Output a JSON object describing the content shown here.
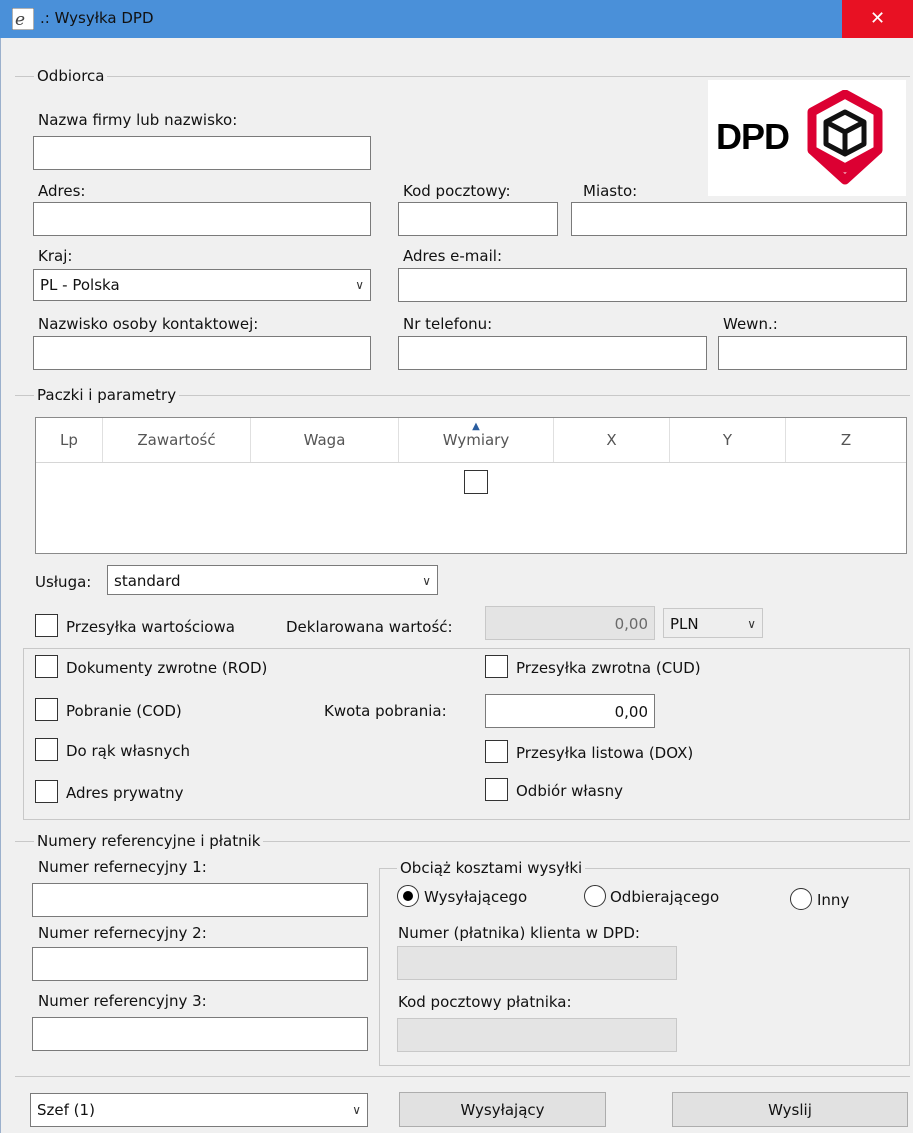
{
  "window": {
    "title": ".: Wysyłka DPD",
    "close_glyph": "✕"
  },
  "recipient": {
    "section_title": "Odbiorca",
    "company_label": "Nazwa firmy lub nazwisko:",
    "company_value": "",
    "address_label": "Adres:",
    "address_value": "",
    "postal_label": "Kod pocztowy:",
    "postal_value": "",
    "city_label": "Miasto:",
    "city_value": "",
    "country_label": "Kraj:",
    "country_value": "PL - Polska",
    "email_label": "Adres e-mail:",
    "email_value": "",
    "contact_label": "Nazwisko osoby kontaktowej:",
    "contact_value": "",
    "phone_label": "Nr telefonu:",
    "phone_value": "",
    "ext_label": "Wewn.:",
    "ext_value": ""
  },
  "logo": {
    "text": "DPD",
    "brand_color": "#dc0032"
  },
  "packages": {
    "section_title": "Paczki i parametry",
    "columns": [
      "Lp",
      "Zawartość",
      "Waga",
      "Wymiary",
      "X",
      "Y",
      "Z"
    ],
    "sorted_column": "Wymiary",
    "service_label": "Usługa:",
    "service_value": "standard",
    "valuable_label": "Przesyłka wartościowa",
    "valuable_checked": false,
    "declared_label": "Deklarowana wartość:",
    "declared_value": "0,00",
    "currency_value": "PLN",
    "options": {
      "rod_label": "Dokumenty zwrotne (ROD)",
      "cud_label": "Przesyłka zwrotna (CUD)",
      "cod_label": "Pobranie (COD)",
      "cod_amount_label": "Kwota pobrania:",
      "cod_amount_value": "0,00",
      "own_hands_label": "Do rąk własnych",
      "dox_label": "Przesyłka listowa (DOX)",
      "private_label": "Adres prywatny",
      "self_pickup_label": "Odbiór własny"
    }
  },
  "references": {
    "section_title": "Numery referencyjne i płatnik",
    "ref1_label": "Numer refernecyjny 1:",
    "ref1_value": "",
    "ref2_label": "Numer refernecyjny 2:",
    "ref2_value": "",
    "ref3_label": "Numer referencyjny 3:",
    "ref3_value": "",
    "payer": {
      "title": "Obciąż kosztami wysyłki",
      "sender_label": "Wysyłającego",
      "receiver_label": "Odbierającego",
      "other_label": "Inny",
      "selected": "Wysyłającego",
      "client_no_label": "Numer (płatnika) klienta w DPD:",
      "client_no_value": "",
      "payer_postal_label": "Kod pocztowy płatnika:",
      "payer_postal_value": ""
    }
  },
  "footer": {
    "user_value": "Szef  (1)",
    "sender_button": "Wysyłający",
    "send_button": "Wyslij"
  }
}
